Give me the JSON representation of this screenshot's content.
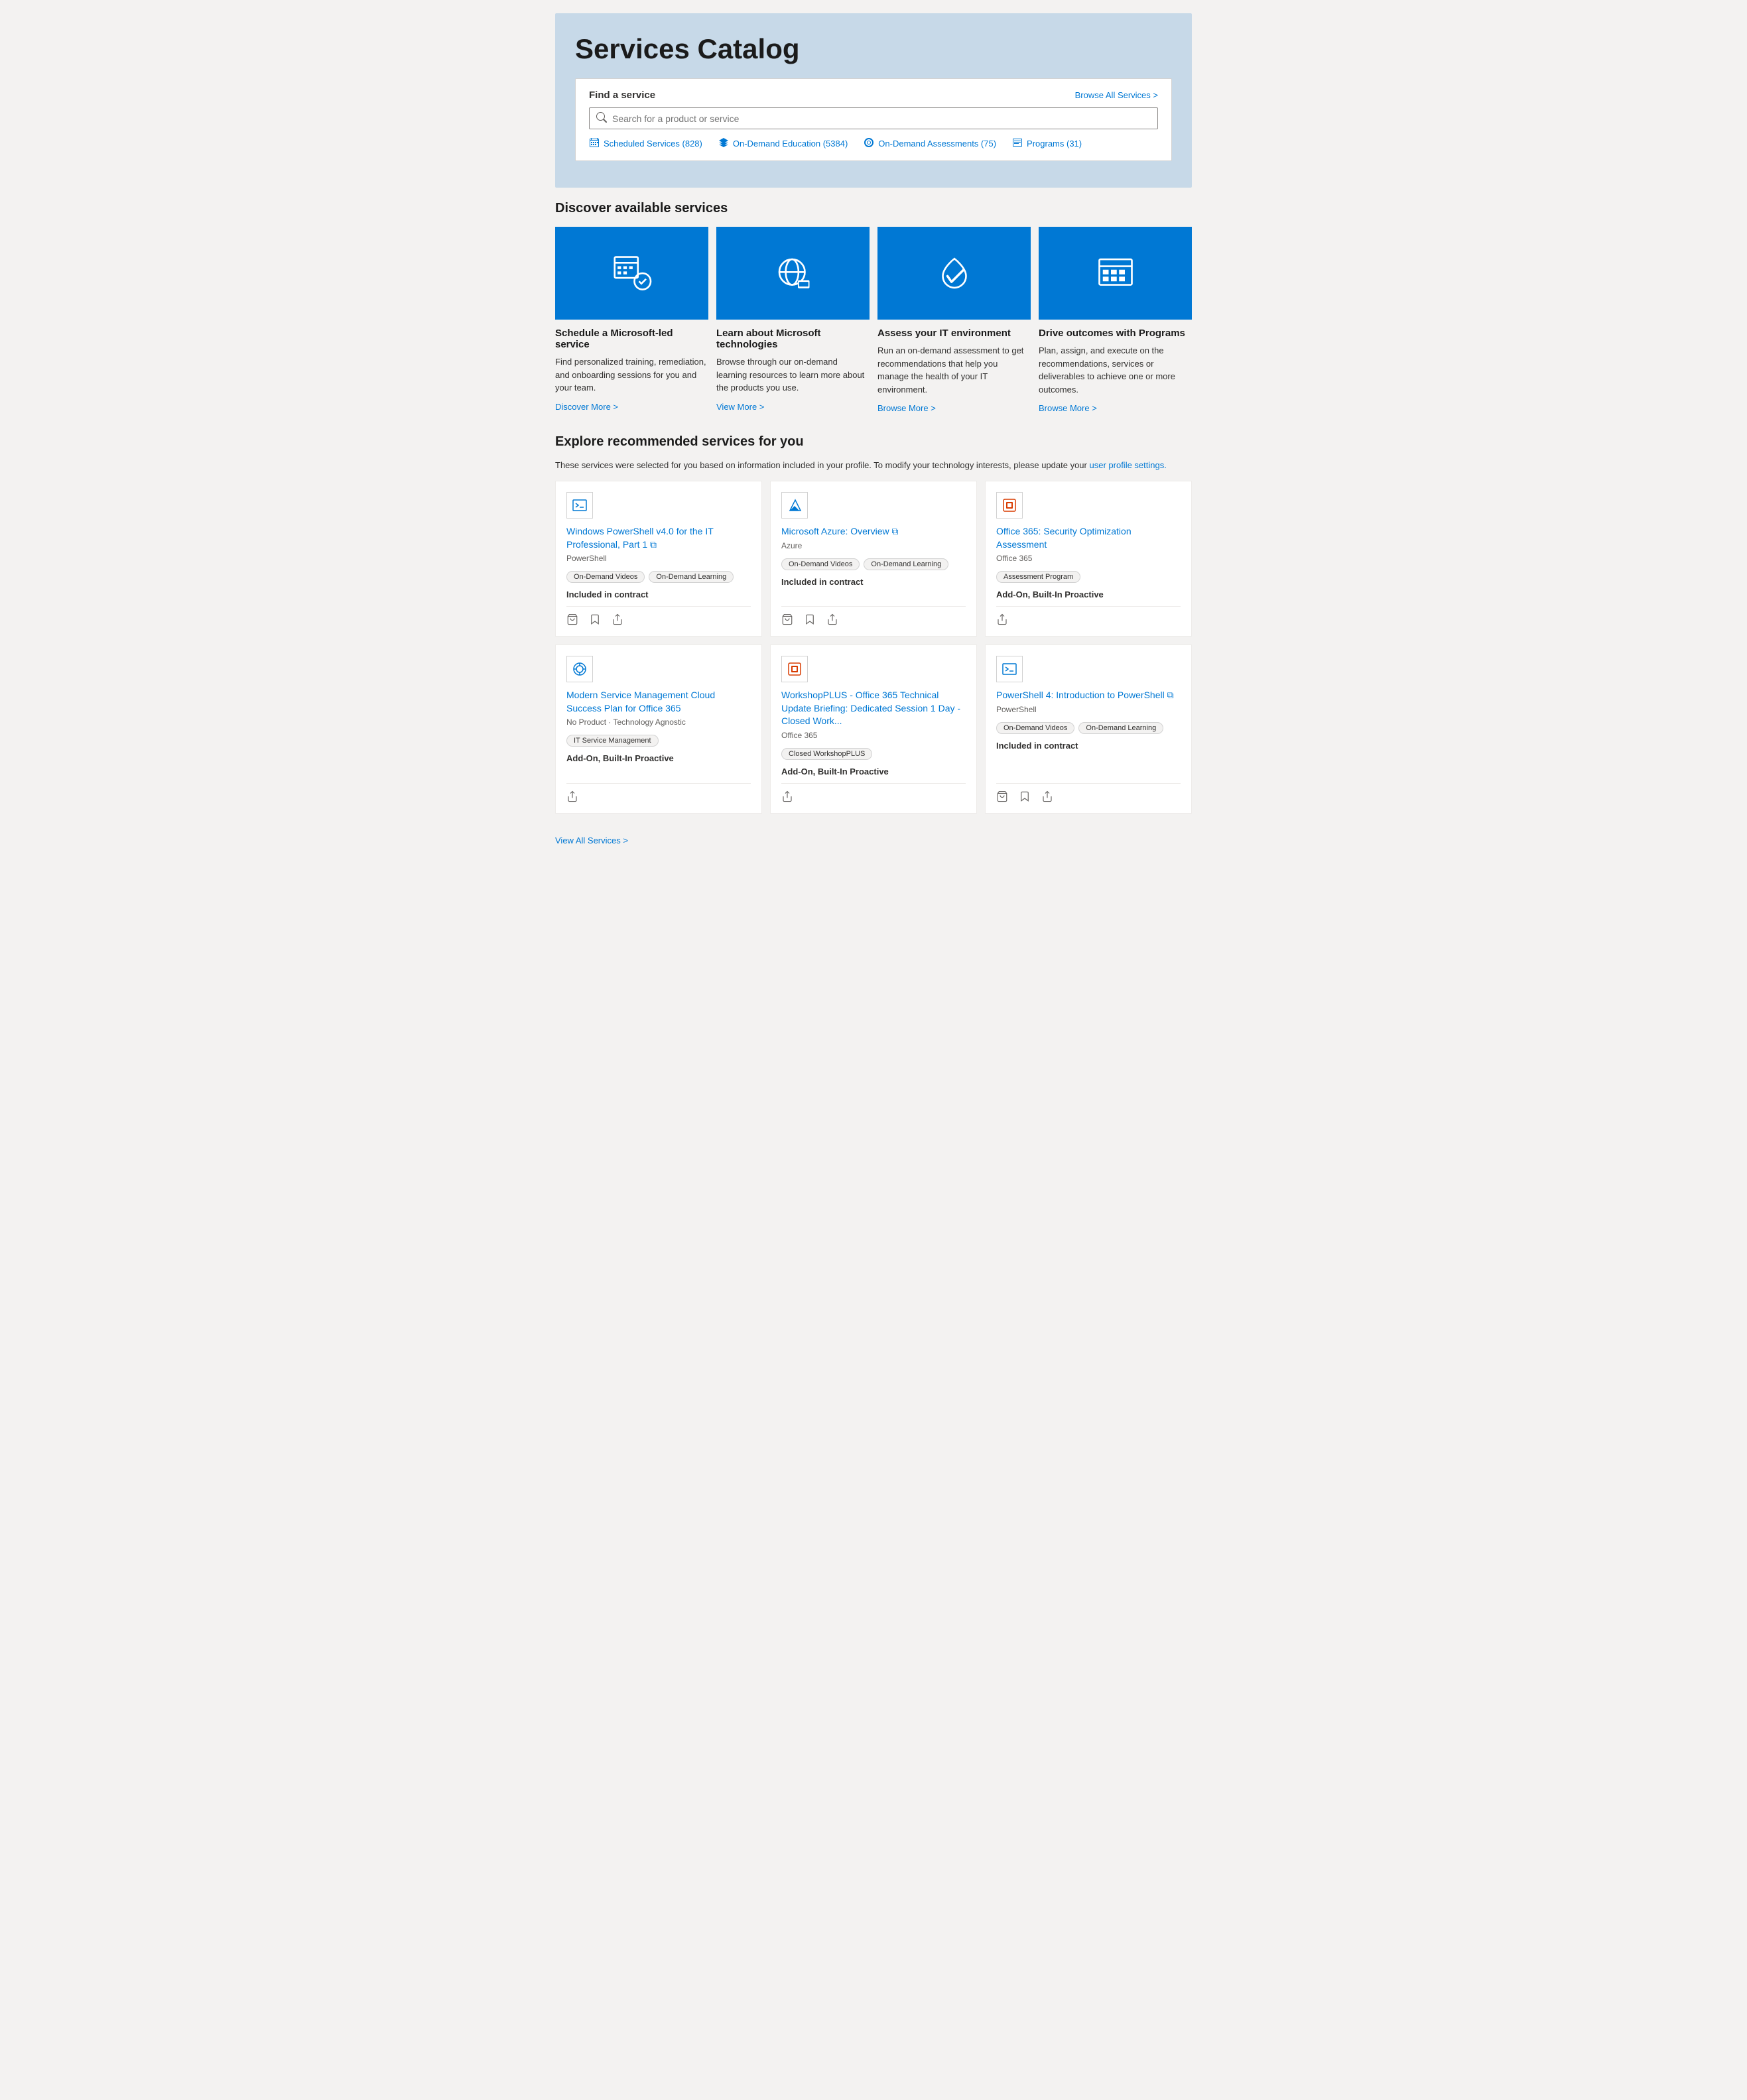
{
  "hero": {
    "title": "Services Catalog"
  },
  "search": {
    "label": "Find a service",
    "browse_all": "Browse All Services >",
    "placeholder": "Search for a product or service",
    "filters": [
      {
        "label": "Scheduled Services (828)",
        "icon": "calendar"
      },
      {
        "label": "On-Demand Education (5384)",
        "icon": "education"
      },
      {
        "label": "On-Demand Assessments (75)",
        "icon": "assessment"
      },
      {
        "label": "Programs (31)",
        "icon": "programs"
      }
    ]
  },
  "discover": {
    "section_title": "Discover available services",
    "cards": [
      {
        "title": "Schedule a Microsoft-led service",
        "description": "Find personalized training, remediation, and onboarding sessions for you and your team.",
        "link": "Discover More >"
      },
      {
        "title": "Learn about Microsoft technologies",
        "description": "Browse through our on-demand learning resources to learn more about the products you use.",
        "link": "View More >"
      },
      {
        "title": "Assess your IT environment",
        "description": "Run an on-demand assessment to get recommendations that help you manage the health of your IT environment.",
        "link": "Browse More >"
      },
      {
        "title": "Drive outcomes with Programs",
        "description": "Plan, assign, and execute on the recommendations, services or deliverables to achieve one or more outcomes.",
        "link": "Browse More >"
      }
    ]
  },
  "recommended": {
    "section_title": "Explore recommended services for you",
    "subtitle": "These services were selected for you based on information included in your profile. To modify your technology interests, please update your",
    "profile_link": "user profile settings.",
    "cards": [
      {
        "title": "Windows PowerShell v4.0 for the IT Professional, Part 1 ⧉",
        "subtitle": "PowerShell",
        "tags": [
          "On-Demand Videos",
          "On-Demand Learning"
        ],
        "contract": "Included in contract",
        "has_cart": true,
        "has_bookmark": true,
        "has_share": true
      },
      {
        "title": "Microsoft Azure: Overview ⧉",
        "subtitle": "Azure",
        "tags": [
          "On-Demand Videos",
          "On-Demand Learning"
        ],
        "contract": "Included in contract",
        "has_cart": true,
        "has_bookmark": true,
        "has_share": true
      },
      {
        "title": "Office 365: Security Optimization Assessment",
        "subtitle": "Office 365",
        "tags": [
          "Assessment Program"
        ],
        "contract": "Add-On, Built-In Proactive",
        "has_cart": false,
        "has_bookmark": false,
        "has_share": true
      },
      {
        "title": "Modern Service Management Cloud Success Plan for Office 365",
        "subtitle": "No Product · Technology Agnostic",
        "tags": [
          "IT Service Management"
        ],
        "contract": "Add-On, Built-In Proactive",
        "has_cart": false,
        "has_bookmark": false,
        "has_share": true
      },
      {
        "title": "WorkshopPLUS - Office 365 Technical Update Briefing: Dedicated Session 1 Day - Closed Work...",
        "subtitle": "Office 365",
        "tags": [
          "Closed WorkshopPLUS"
        ],
        "contract": "Add-On, Built-In Proactive",
        "has_cart": false,
        "has_bookmark": false,
        "has_share": true
      },
      {
        "title": "PowerShell 4: Introduction to PowerShell ⧉",
        "subtitle": "PowerShell",
        "tags": [
          "On-Demand Videos",
          "On-Demand Learning"
        ],
        "contract": "Included in contract",
        "has_cart": true,
        "has_bookmark": true,
        "has_share": true
      }
    ]
  },
  "view_all": "View All Services >"
}
